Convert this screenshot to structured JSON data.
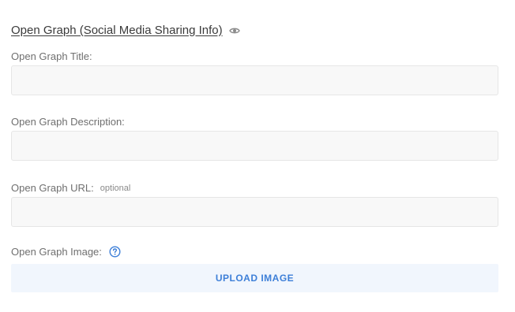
{
  "section": {
    "title": "Open Graph (Social Media Sharing Info)",
    "preview_icon": "eye-icon"
  },
  "fields": {
    "og_title": {
      "label": "Open Graph Title:",
      "value": "",
      "placeholder": ""
    },
    "og_description": {
      "label": "Open Graph Description:",
      "value": "",
      "placeholder": ""
    },
    "og_url": {
      "label": "Open Graph URL:",
      "optional_label": "optional",
      "value": "",
      "placeholder": ""
    },
    "og_image": {
      "label": "Open Graph Image:",
      "help_icon": "help-circle-icon",
      "upload_label": "UPLOAD IMAGE"
    }
  },
  "colors": {
    "accent": "#3d7fd8",
    "upload_background": "#f1f6fd",
    "input_background": "#f8f8f8",
    "input_border": "#e6e6e6"
  }
}
